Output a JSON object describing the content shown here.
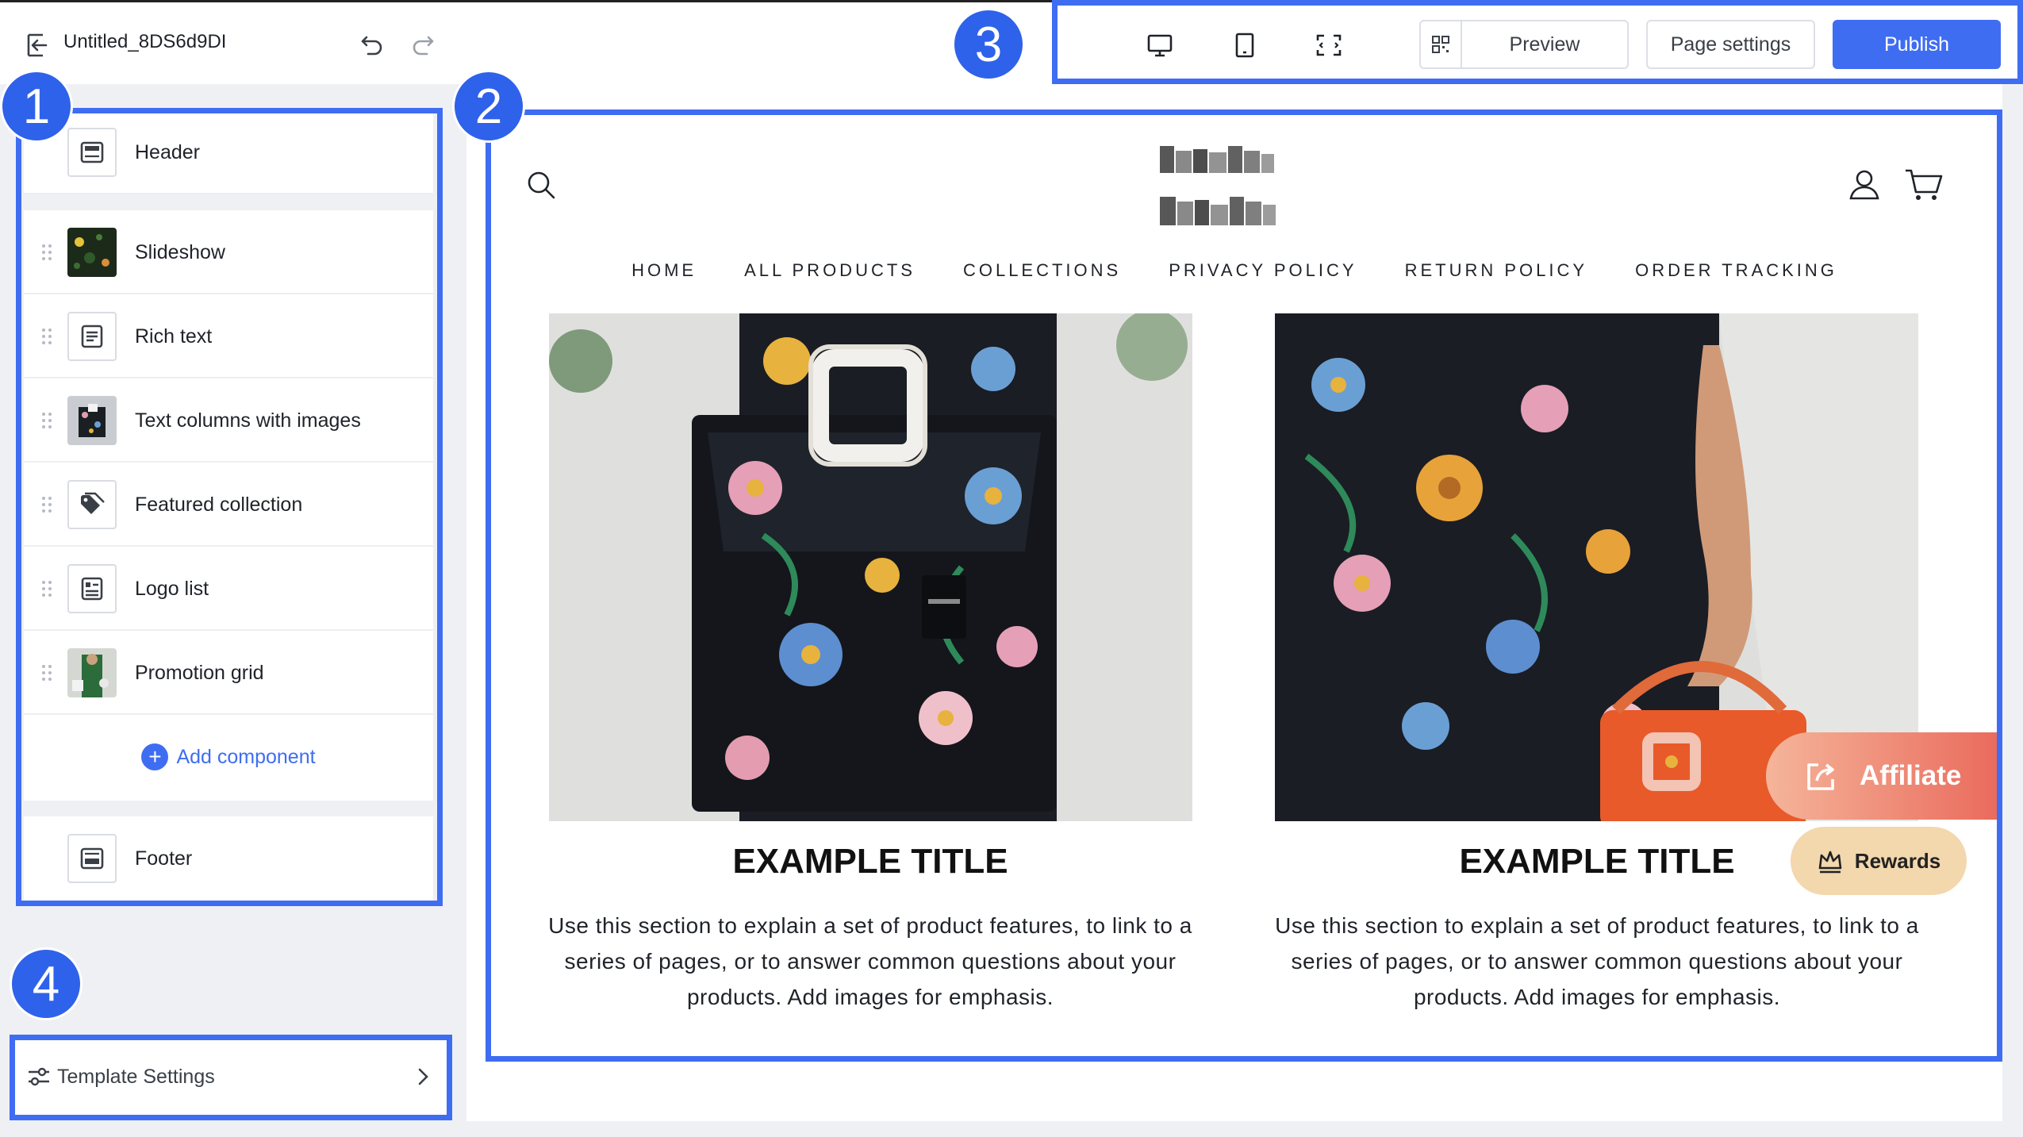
{
  "topbar": {
    "title": "Untitled_8DS6d9DI",
    "preview_label": "Preview",
    "page_settings_label": "Page settings",
    "publish_label": "Publish",
    "device_icons": [
      "desktop-icon",
      "tablet-icon",
      "fullscreen-icon"
    ]
  },
  "sidebar": {
    "header_label": "Header",
    "items": [
      {
        "label": "Slideshow",
        "icon": "slideshow-thumbnail"
      },
      {
        "label": "Rich text",
        "icon": "rich-text-icon"
      },
      {
        "label": "Text columns with images",
        "icon": "text-columns-thumbnail"
      },
      {
        "label": "Featured collection",
        "icon": "tag-icon"
      },
      {
        "label": "Logo list",
        "icon": "logo-list-icon"
      },
      {
        "label": "Promotion grid",
        "icon": "promotion-grid-thumbnail"
      }
    ],
    "add_component_label": "Add component",
    "footer_label": "Footer"
  },
  "template_settings": {
    "label": "Template Settings"
  },
  "store": {
    "nav": [
      "HOME",
      "ALL PRODUCTS",
      "COLLECTIONS",
      "PRIVACY POLICY",
      "RETURN POLICY",
      "ORDER TRACKING"
    ],
    "cards": [
      {
        "title": "EXAMPLE TITLE",
        "text": "Use this section to explain a set of product features, to link to a series of pages, or to answer common questions about your products. Add images for emphasis."
      },
      {
        "title": "EXAMPLE TITLE",
        "text": "Use this section to explain a set of product features, to link to a series of pages, or to answer common questions about your products. Add images for emphasis."
      }
    ],
    "affiliate_label": "Affiliate",
    "rewards_label": "Rewards"
  },
  "annotations": {
    "badges": [
      "1",
      "2",
      "3",
      "4"
    ]
  },
  "colors": {
    "accent": "#3f6df2",
    "affiliate_gradient_start": "#f5b59a",
    "affiliate_gradient_end": "#ea6b5d",
    "rewards_bg": "#f3d7ad"
  }
}
